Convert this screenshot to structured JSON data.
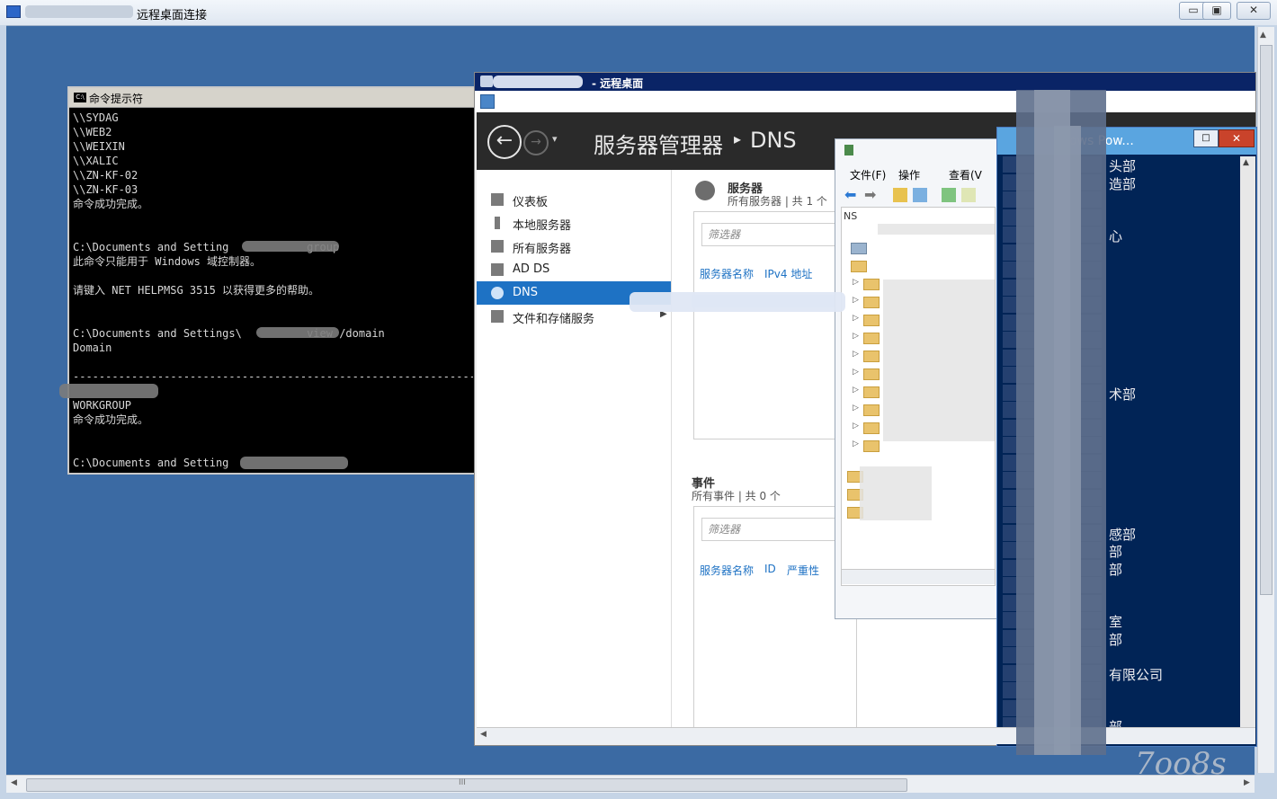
{
  "outer_window": {
    "title": "远程桌面连接",
    "min": "▭",
    "max": "▣",
    "close": "✕",
    "hscroll_grip": "III"
  },
  "cmd": {
    "title": "命令提示符",
    "icon_label": "C:\\",
    "lines": [
      "\\\\SYDAG",
      "\\\\WEB2",
      "\\\\WEIXIN",
      "\\\\XALIC",
      "\\\\ZN-KF-02",
      "\\\\ZN-KF-03",
      "命令成功完成。",
      "",
      "",
      "C:\\Documents and Setting            group",
      "此命令只能用于 Windows 域控制器。",
      "",
      "请键入 NET HELPMSG 3515 以获得更多的帮助。",
      "",
      "",
      "C:\\Documents and Settings\\          view /domain",
      "Domain",
      "",
      "--------------------------------------------------------------",
      "",
      "WORKGROUP",
      "命令成功完成。",
      "",
      "",
      "C:\\Documents and Setting"
    ]
  },
  "remote_desktop": {
    "title": "- 远程桌面"
  },
  "server_manager": {
    "back": "←",
    "forward": "→",
    "dropdown": "▾",
    "title": "服务器管理器",
    "separator": "▸",
    "page": "DNS",
    "nav": [
      {
        "label": "仪表板",
        "icon": "dashboard-icon"
      },
      {
        "label": "本地服务器",
        "icon": "local-server-icon"
      },
      {
        "label": "所有服务器",
        "icon": "all-servers-icon"
      },
      {
        "label": "AD DS",
        "icon": "adds-icon"
      },
      {
        "label": "DNS",
        "icon": "dns-icon",
        "active": true
      },
      {
        "label": "文件和存储服务",
        "icon": "file-storage-icon",
        "arrow": "▶"
      }
    ],
    "servers_section": {
      "title": "服务器",
      "subtitle": "所有服务器 | 共 1 个",
      "filter_placeholder": "筛选器",
      "columns": [
        "服务器名称",
        "IPv4 地址"
      ]
    },
    "events_section": {
      "title": "事件",
      "subtitle": "所有事件 | 共 0 个",
      "filter_placeholder": "筛选器",
      "columns": [
        "服务器名称",
        "ID",
        "严重性"
      ]
    }
  },
  "dns_manager": {
    "menu": [
      "文件(F)",
      "操作",
      "查看(V"
    ],
    "root": "NS"
  },
  "powershell": {
    "title": "ows Pow...",
    "max": "□",
    "close": "✕",
    "lines": [
      {
        "text": "头部"
      },
      {
        "text": "造部"
      },
      {
        "text": ""
      },
      {
        "text": ""
      },
      {
        "text": "心"
      },
      {
        "text": ""
      },
      {
        "text": ""
      },
      {
        "text": ""
      },
      {
        "text": ""
      },
      {
        "text": ""
      },
      {
        "text": ""
      },
      {
        "text": ""
      },
      {
        "text": ""
      },
      {
        "text": "术部"
      },
      {
        "text": ""
      },
      {
        "text": ""
      },
      {
        "text": ""
      },
      {
        "text": ""
      },
      {
        "text": ""
      },
      {
        "text": ""
      },
      {
        "text": ""
      },
      {
        "text": "感部"
      },
      {
        "text": "部"
      },
      {
        "text": "部"
      },
      {
        "text": ""
      },
      {
        "text": ""
      },
      {
        "text": "室"
      },
      {
        "text": "部"
      },
      {
        "text": ""
      },
      {
        "text": "有限公司"
      },
      {
        "text": ""
      },
      {
        "text": ""
      },
      {
        "text": "部"
      }
    ]
  },
  "watermark": "7oo8s"
}
